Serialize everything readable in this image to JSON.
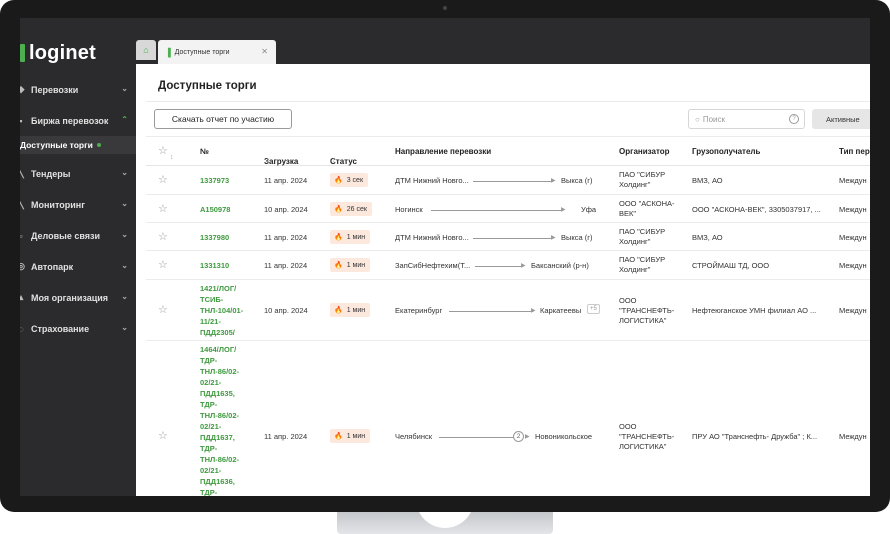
{
  "sidebar": {
    "logo": "loginet",
    "items": [
      {
        "label": "Перевозки",
        "icon": "truck-icon"
      },
      {
        "label": "Биржа перевозок",
        "icon": "exchange-icon",
        "open": true
      },
      {
        "label": "Тендеры",
        "icon": "tender-icon"
      },
      {
        "label": "Мониторинг",
        "icon": "monitoring-icon"
      },
      {
        "label": "Деловые связи",
        "icon": "contacts-icon"
      },
      {
        "label": "Автопарк",
        "icon": "fleet-icon"
      },
      {
        "label": "Моя организация",
        "icon": "organization-icon"
      },
      {
        "label": "Страхование",
        "icon": "insurance-icon"
      }
    ],
    "subitem": "Доступные торги"
  },
  "tabs": {
    "home_icon": "home-icon",
    "page_tab": "Доступные торги"
  },
  "page": {
    "title": "Доступные торги",
    "report_button": "Скачать отчет по участию",
    "search_placeholder": "Поиск",
    "active_button": "Активные"
  },
  "table": {
    "headers": {
      "num": "№",
      "load": "Загрузка",
      "status": "Статус",
      "route": "Направление перевозки",
      "organizer": "Организатор",
      "consignee": "Грузополучатель",
      "type": "Тип пер"
    },
    "rows": [
      {
        "num": "1337973",
        "date": "11 апр. 2024",
        "status": "3 сек",
        "from": "ДТМ Нижний Новго...",
        "to": "Выкса (г)",
        "stops": "",
        "extra": "",
        "organizer": "ПАО \"СИБУР\nХолдинг\"",
        "consignee": "ВМЗ, АО",
        "type": "Междун"
      },
      {
        "num": "А150978",
        "date": "10 апр. 2024",
        "status": "26 сек",
        "from": "Ногинск",
        "to": "Уфа",
        "stops": "",
        "extra": "",
        "organizer": "ООО \"АСКОНА-\nВЕК\"",
        "consignee": "ООО \"АСКОНА-ВЕК\", 3305037917, ...",
        "type": "Междун"
      },
      {
        "num": "1337980",
        "date": "11 апр. 2024",
        "status": "1 мин",
        "from": "ДТМ Нижний Новго...",
        "to": "Выкса (г)",
        "stops": "",
        "extra": "",
        "organizer": "ПАО \"СИБУР\nХолдинг\"",
        "consignee": "ВМЗ, АО",
        "type": "Междун"
      },
      {
        "num": "1331310",
        "date": "11 апр. 2024",
        "status": "1 мин",
        "from": "ЗапСибНефтехим(Т...",
        "to": "Баксанский (р-н)",
        "stops": "",
        "extra": "",
        "organizer": "ПАО \"СИБУР\nХолдинг\"",
        "consignee": "СТРОЙМАШ ТД, ООО",
        "type": "Междун"
      },
      {
        "num": "1421/ЛОГ/\nТСИБ-\nТНЛ-104/01-\n11/21-\nПДД2305/",
        "date": "10 апр. 2024",
        "status": "1 мин",
        "from": "Екатеринбург",
        "to": "Каркатеевы",
        "stops": "",
        "extra": "+5",
        "organizer": "ООО\n\"ТРАНСНЕФТЬ-\nЛОГИСТИКА\"",
        "consignee": "Нефтеюганское УМН филиал АО ...",
        "type": "Междун"
      },
      {
        "num": "1464/ЛОГ/\nТДР-\nТНЛ-86/02-\n02/21-\nПДД1635,\nТДР-\nТНЛ-86/02-\n02/21-\nПДД1637,\nТДР-\nТНЛ-86/02-\n02/21-\nПДД1636,\nТДР-",
        "date": "11 апр. 2024",
        "status": "1 мин",
        "from": "Челябинск",
        "to": "Новоникольское",
        "stops": "2",
        "extra": "",
        "organizer": "ООО\n\"ТРАНСНЕФТЬ-\nЛОГИСТИКА\"",
        "consignee": "ПРУ АО \"Транснефть- Дружба\" ; К...",
        "type": "Междун"
      }
    ]
  }
}
